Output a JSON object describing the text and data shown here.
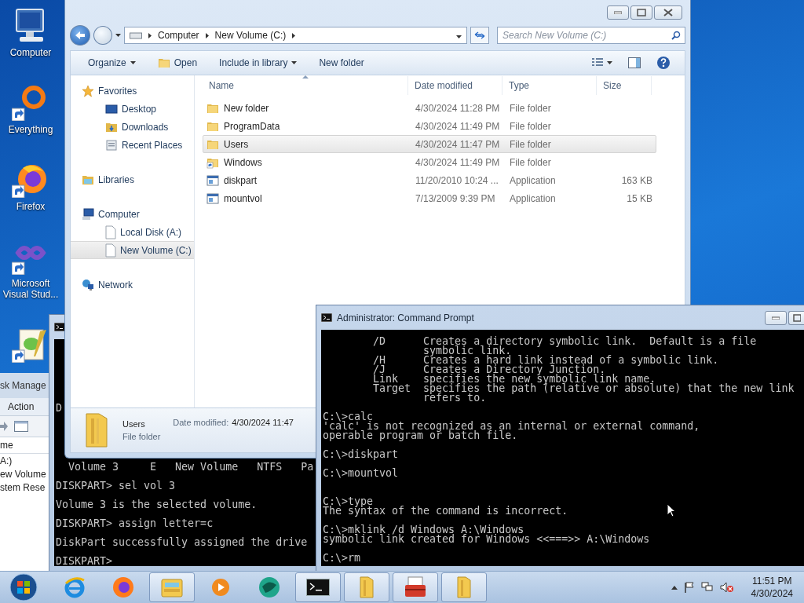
{
  "desktop_icons": [
    {
      "kind": "computer",
      "label": "Computer"
    },
    {
      "kind": "everything",
      "label": "Everything"
    },
    {
      "kind": "firefox",
      "label": "Firefox"
    },
    {
      "kind": "visual-studio",
      "label": "Microsoft Visual Stud..."
    },
    {
      "kind": "notepad"
    }
  ],
  "disk_management": {
    "title": "sk Manage",
    "menu": [
      "Action"
    ],
    "column": "me",
    "rows": [
      "A:)",
      "ew Volume",
      "stem Rese"
    ]
  },
  "diskpart": {
    "top_fragment": "D",
    "text": "  Volume 3     E   New Volume   NTFS   Pa\n\nDISKPART> sel vol 3\n\nVolume 3 is the selected volume.\n\nDISKPART> assign letter=c\n\nDiskPart successfully assigned the drive\n\nDISKPART>"
  },
  "explorer": {
    "address": [
      "Computer",
      "New Volume (C:)"
    ],
    "search": {
      "placeholder": "Search New Volume (C:)"
    },
    "toolbar": [
      {
        "kind": "menu",
        "label": "Organize"
      },
      {
        "kind": "open",
        "label": "Open"
      },
      {
        "kind": "menu",
        "label": "Include in library"
      },
      {
        "kind": "plain",
        "label": "New folder"
      }
    ],
    "nav": [
      {
        "kind": "favorites",
        "label": "Favorites",
        "selected": false,
        "children": [
          {
            "kind": "desktop",
            "label": "Desktop",
            "selected": false
          },
          {
            "kind": "downloads",
            "label": "Downloads",
            "selected": false
          },
          {
            "kind": "recent",
            "label": "Recent Places",
            "selected": false
          }
        ]
      },
      {
        "kind": "libraries",
        "label": "Libraries",
        "selected": false
      },
      {
        "kind": "computer",
        "label": "Computer",
        "selected": false,
        "children": [
          {
            "kind": "drive",
            "label": "Local Disk (A:)",
            "selected": false
          },
          {
            "kind": "drive",
            "label": "New Volume (C:)",
            "selected": true
          }
        ]
      },
      {
        "kind": "network",
        "label": "Network",
        "selected": false
      }
    ],
    "columns": [
      "Name",
      "Date modified",
      "Type",
      "Size"
    ],
    "rows": [
      {
        "kind": "folder",
        "name": "New folder",
        "date": "4/30/2024 11:28 PM",
        "type": "File folder",
        "selected": false
      },
      {
        "kind": "folder",
        "name": "ProgramData",
        "date": "4/30/2024 11:49 PM",
        "type": "File folder",
        "selected": false
      },
      {
        "kind": "folder",
        "name": "Users",
        "date": "4/30/2024 11:47 PM",
        "type": "File folder",
        "selected": true
      },
      {
        "kind": "link",
        "name": "Windows",
        "date": "4/30/2024 11:49 PM",
        "type": "File folder",
        "selected": false
      },
      {
        "kind": "app",
        "name": "diskpart",
        "date": "11/20/2010 10:24 ...",
        "type": "Application",
        "size": "163 KB",
        "selected": false
      },
      {
        "kind": "app",
        "name": "mountvol",
        "date": "7/13/2009 9:39 PM",
        "type": "Application",
        "size": "15 KB",
        "selected": false
      }
    ],
    "details": {
      "name": "Users",
      "type": "File folder",
      "date_label": "Date modified:",
      "date": "4/30/2024 11:47"
    }
  },
  "command_prompt": {
    "title": "Administrator: Command Prompt",
    "blocks": [
      "        /D      Creates a directory symbolic link.  Default is a file\n                symbolic link.\n        /H      Creates a hard link instead of a symbolic link.\n        /J      Creates a Directory Junction.\n        Link    specifies the new symbolic link name.\n        Target  specifies the path (relative or absolute) that the new link\n                refers to.\n\nC:\\>calc\n'calc' is not recognized as an internal or external command,\noperable program or batch file.\n\nC:\\>diskpart\n\nC:\\>mountvol",
      "C:\\>type\nThe syntax of the command is incorrect.\n\nC:\\>mklink /d Windows A:\\Windows\nsymbolic link created for Windows <<===>> A:\\Windows\n\nC:\\>rm"
    ]
  },
  "taskbar": {
    "items": [
      {
        "kind": "ie",
        "running": false
      },
      {
        "kind": "firefox",
        "running": false
      },
      {
        "kind": "explorer",
        "running": true
      },
      {
        "kind": "media",
        "running": false
      },
      {
        "kind": "globe",
        "running": false
      },
      {
        "kind": "cmd",
        "running": true
      },
      {
        "kind": "folder",
        "running": true
      },
      {
        "kind": "toolbox",
        "running": true
      },
      {
        "kind": "folder",
        "running": true
      }
    ],
    "time": "11:51 PM",
    "date": "4/30/2024"
  }
}
